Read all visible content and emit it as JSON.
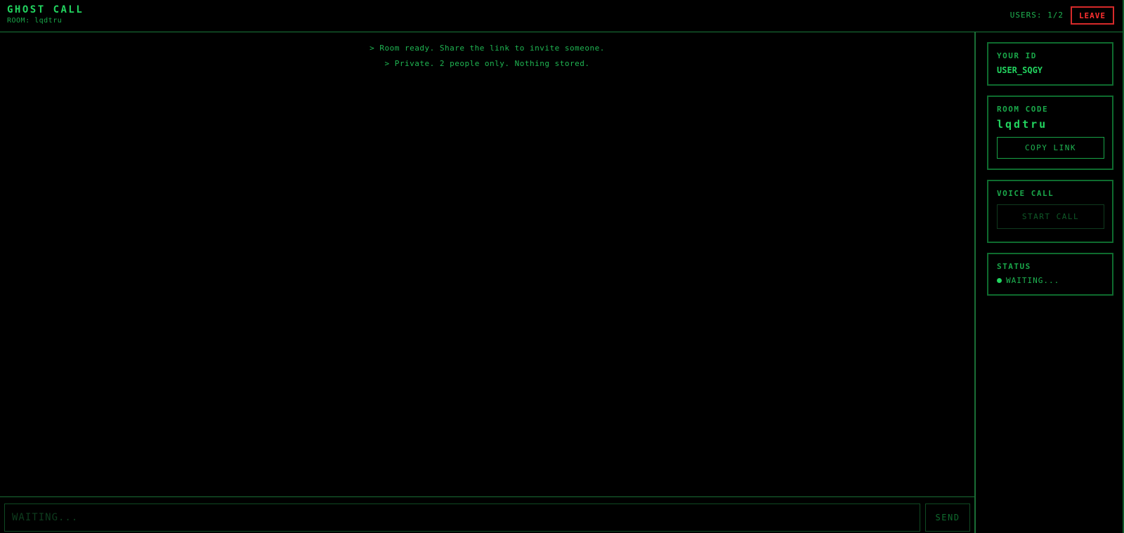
{
  "header": {
    "title": "GHOST CALL",
    "room_line": "ROOM: lqdtru",
    "users": "USERS: 1/2",
    "leave_label": "LEAVE"
  },
  "chat": {
    "messages": [
      "> Room ready. Share the link to invite someone.",
      "> Private. 2 people only. Nothing stored."
    ]
  },
  "input": {
    "placeholder": "WAITING...",
    "value": "",
    "send_label": "SEND"
  },
  "sidebar": {
    "your_id": {
      "label": "YOUR ID",
      "value": "USER_SQGY"
    },
    "room_code": {
      "label": "ROOM CODE",
      "value": "lqdtru",
      "copy_label": "COPY LINK"
    },
    "voice_call": {
      "label": "VOICE CALL",
      "button_label": "START CALL"
    },
    "status": {
      "label": "STATUS",
      "value": "WAITING..."
    }
  },
  "colors": {
    "background": "#000000",
    "accent": "#22d45f",
    "danger": "#ff3030",
    "border": "#0e6b2e"
  },
  "icons": {
    "status": "status-dot-icon"
  }
}
